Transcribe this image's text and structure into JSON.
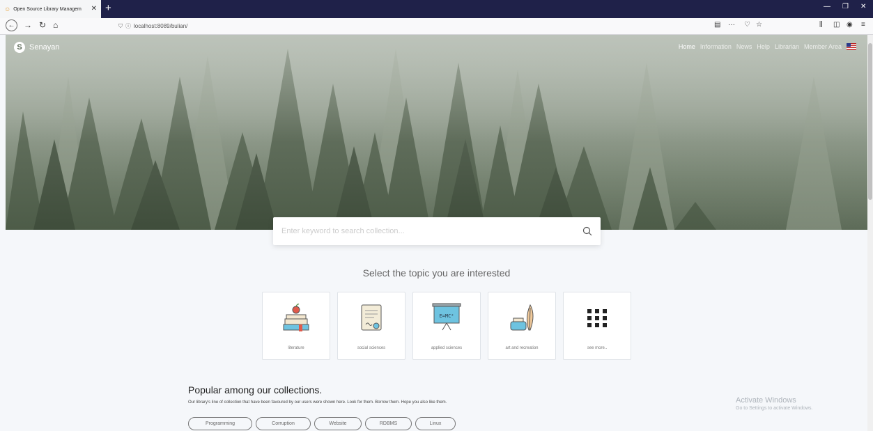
{
  "browser": {
    "tab_title": "Open Source Library Managem",
    "tab_close": "✕",
    "new_tab": "+",
    "url": "localhost:8089/bulian/",
    "window_minimize": "—",
    "window_maximize": "❐",
    "window_close": "✕"
  },
  "site": {
    "brand": "Senayan",
    "brand_logo_letter": "S",
    "menu": [
      {
        "label": "Home",
        "active": true
      },
      {
        "label": "Information"
      },
      {
        "label": "News"
      },
      {
        "label": "Help"
      },
      {
        "label": "Librarian"
      },
      {
        "label": "Member Area"
      }
    ]
  },
  "search": {
    "placeholder": "Enter keyword to search collection..."
  },
  "topics": {
    "title": "Select the topic you are interested",
    "items": [
      {
        "label": "literature",
        "icon": "books-apple-icon"
      },
      {
        "label": "social sciences",
        "icon": "certificate-icon"
      },
      {
        "label": "applied sciences",
        "icon": "blackboard-icon"
      },
      {
        "label": "art and recreation",
        "icon": "ink-feather-icon"
      },
      {
        "label": "see more..",
        "icon": "grid-icon"
      }
    ]
  },
  "popular": {
    "title": "Popular among our collections.",
    "description": "Our library's line of collection that have been favoured by our users were shown here. Look for them. Borrow them. Hope you also like them.",
    "tags": [
      "Programming",
      "Corruption",
      "Website",
      "RDBMS",
      "Linux"
    ]
  },
  "watermark": {
    "line1": "Activate Windows",
    "line2": "Go to Settings to activate Windows."
  }
}
